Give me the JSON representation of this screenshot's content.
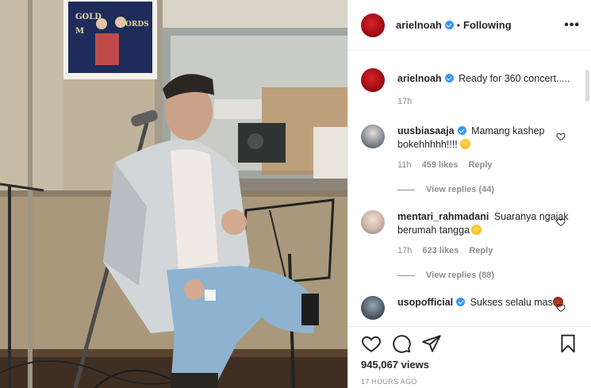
{
  "header": {
    "username": "arielnoah",
    "separator": "•",
    "follow_status": "Following",
    "more": "•••"
  },
  "caption": {
    "username": "arielnoah",
    "text": "Ready for 360 concert.....",
    "time": "17h"
  },
  "comments": [
    {
      "username": "uusbiasaaja",
      "verified": true,
      "text": "Mamang kashep bokehhhhh!!!! ",
      "emoji": "scream-emoji",
      "time": "11h",
      "likes": "459 likes",
      "reply": "Reply",
      "view_replies": "View replies (44)"
    },
    {
      "username": "mentari_rahmadani",
      "verified": false,
      "text": "Suaranya ngajak berumah tangga",
      "emoji": "laughing-emoji",
      "time": "17h",
      "likes": "623 likes",
      "reply": "Reply",
      "view_replies": "View replies (88)"
    },
    {
      "username": "usopofficial",
      "verified": true,
      "text": "Sukses selalu mas",
      "emoji": "fire-emoji"
    }
  ],
  "footer": {
    "views": "945,067 views",
    "ago": "17 HOURS AGO",
    "icons": [
      "heart-icon",
      "comment-icon",
      "share-icon",
      "bookmark-icon"
    ]
  },
  "media": {
    "poster_text": "GOLD RECORDS",
    "poster_text_line1": "GOLD",
    "poster_text_line2": "M",
    "poster_text_line3": "ORDS"
  },
  "colors": {
    "verified": "#3897f0",
    "secondary_text": "#8e8e8e",
    "primary_text": "#262626",
    "border": "#efefef"
  }
}
